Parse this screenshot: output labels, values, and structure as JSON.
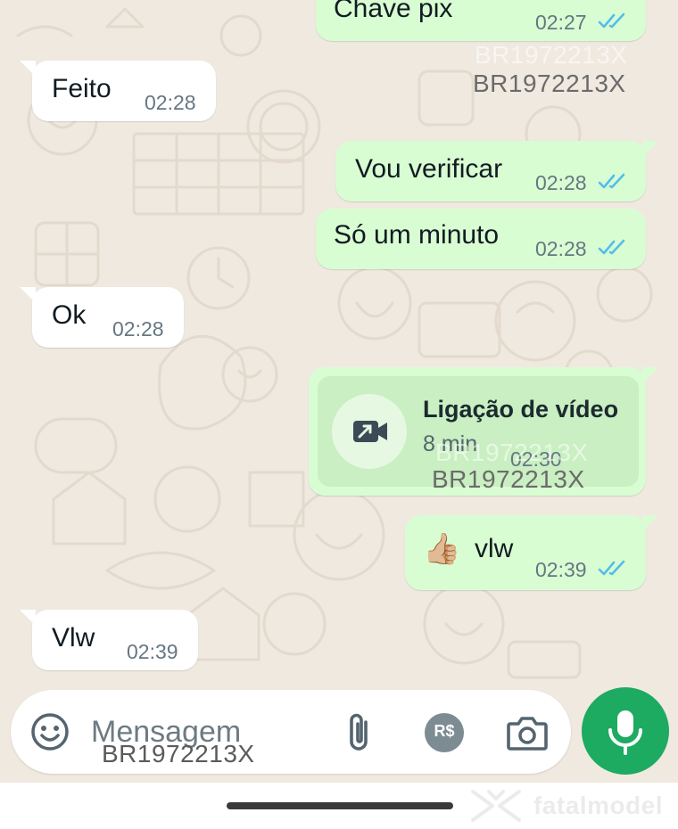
{
  "chat": {
    "messages": [
      {
        "id": "m1",
        "direction": "out",
        "text": "Chave pix",
        "time": "02:27",
        "status": "read"
      },
      {
        "id": "m2",
        "direction": "in",
        "text": "Feito",
        "time": "02:28"
      },
      {
        "id": "m3",
        "direction": "out",
        "text": "Vou verificar",
        "time": "02:28",
        "status": "read"
      },
      {
        "id": "m4",
        "direction": "out",
        "text": "Só um minuto",
        "time": "02:28",
        "status": "read"
      },
      {
        "id": "m5",
        "direction": "in",
        "text": "Ok",
        "time": "02:28"
      },
      {
        "id": "m6",
        "direction": "out",
        "type": "video_call",
        "title": "Ligação de vídeo",
        "duration": "8 min",
        "time": "02:30"
      },
      {
        "id": "m7",
        "direction": "out",
        "emoji": "👍🏼",
        "text": "vlw",
        "time": "02:39",
        "status": "read"
      },
      {
        "id": "m8",
        "direction": "in",
        "text": "Vlw",
        "time": "02:39"
      }
    ]
  },
  "watermark": {
    "text": "BR1972213X",
    "brand": "fatalmodel"
  },
  "composer": {
    "placeholder": "Mensagem",
    "icons": [
      "emoji-icon",
      "attach-icon",
      "payment-icon",
      "camera-icon",
      "mic-icon"
    ],
    "payment_label": "R$"
  },
  "colors": {
    "outgoing_bubble": "#d9fdd3",
    "incoming_bubble": "#ffffff",
    "read_tick": "#53bdeb",
    "accent": "#1daa61",
    "chat_background": "#efe9e0"
  }
}
